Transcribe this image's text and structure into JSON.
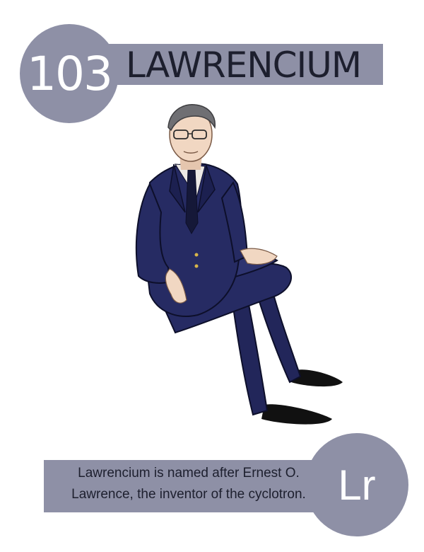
{
  "element": {
    "atomic_number": "103",
    "name": "LAWRENCIUM",
    "symbol": "Lr"
  },
  "caption": {
    "line1": "Lawrencium is named after Ernest O.",
    "line2": "Lawrence, the inventor of the cyclotron."
  },
  "colors": {
    "accent": "#8e90a6",
    "title_text": "#1d1f2e",
    "suit": "#24285a",
    "skin": "#f1d7c2"
  },
  "illustration": "seated-man-in-navy-suit-illustration"
}
